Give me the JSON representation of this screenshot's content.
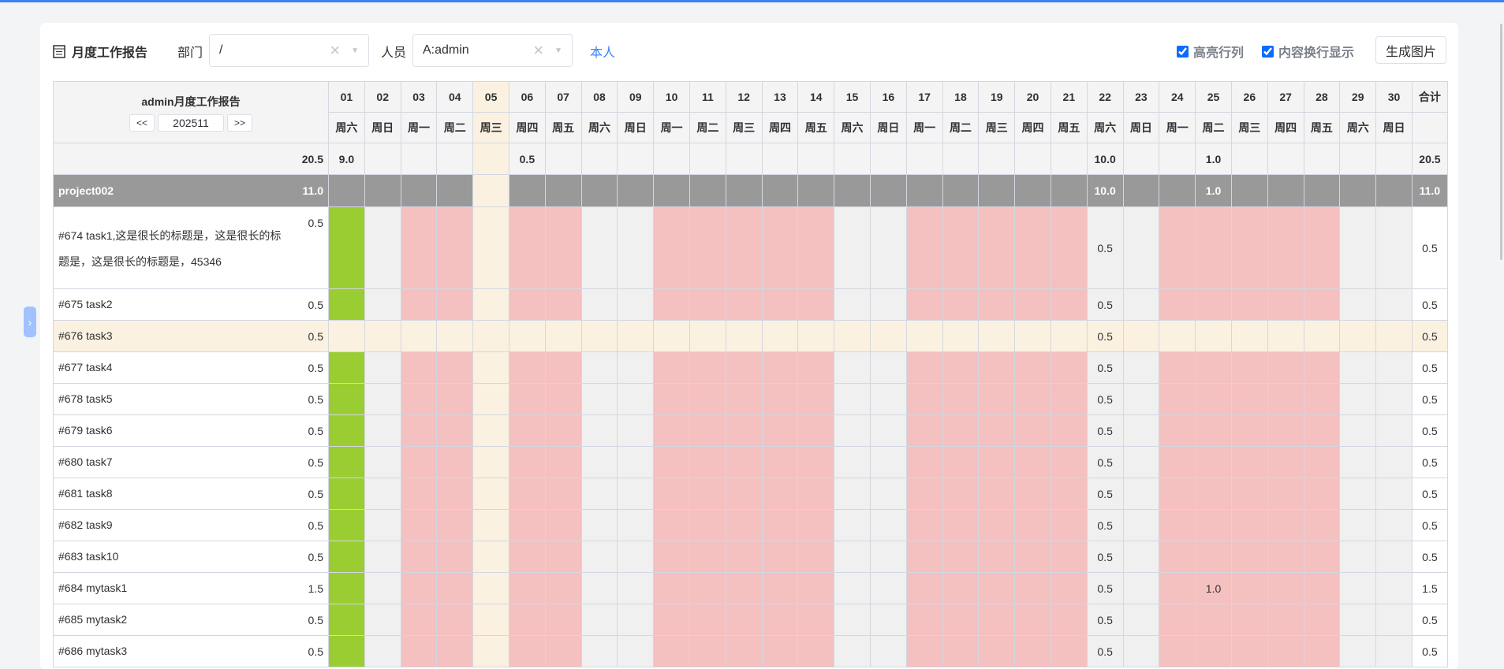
{
  "toolbar": {
    "title": "月度工作报告",
    "dept_label": "部门",
    "dept_value": "/",
    "person_label": "人员",
    "person_value": "A:admin",
    "self_link": "本人",
    "highlight_label": "高亮行列",
    "wrap_label": "内容换行显示",
    "generate_button": "生成图片"
  },
  "report": {
    "title": "admin月度工作报告",
    "prev": "<<",
    "month": "202511",
    "next": ">>",
    "total_label": "合计",
    "highlight_col": "05",
    "highlight_row": "#676 task3"
  },
  "days": [
    {
      "d": "01",
      "w": "周六",
      "status": "full"
    },
    {
      "d": "02",
      "w": "周日",
      "status": "weekend"
    },
    {
      "d": "03",
      "w": "周一",
      "status": "under"
    },
    {
      "d": "04",
      "w": "周二",
      "status": "under"
    },
    {
      "d": "05",
      "w": "周三",
      "status": "under"
    },
    {
      "d": "06",
      "w": "周四",
      "status": "under"
    },
    {
      "d": "07",
      "w": "周五",
      "status": "under"
    },
    {
      "d": "08",
      "w": "周六",
      "status": "weekend"
    },
    {
      "d": "09",
      "w": "周日",
      "status": "weekend"
    },
    {
      "d": "10",
      "w": "周一",
      "status": "under"
    },
    {
      "d": "11",
      "w": "周二",
      "status": "under"
    },
    {
      "d": "12",
      "w": "周三",
      "status": "under"
    },
    {
      "d": "13",
      "w": "周四",
      "status": "under"
    },
    {
      "d": "14",
      "w": "周五",
      "status": "under"
    },
    {
      "d": "15",
      "w": "周六",
      "status": "weekend"
    },
    {
      "d": "16",
      "w": "周日",
      "status": "weekend"
    },
    {
      "d": "17",
      "w": "周一",
      "status": "under"
    },
    {
      "d": "18",
      "w": "周二",
      "status": "under"
    },
    {
      "d": "19",
      "w": "周三",
      "status": "under"
    },
    {
      "d": "20",
      "w": "周四",
      "status": "under"
    },
    {
      "d": "21",
      "w": "周五",
      "status": "under"
    },
    {
      "d": "22",
      "w": "周六",
      "status": "weekend"
    },
    {
      "d": "23",
      "w": "周日",
      "status": "weekend"
    },
    {
      "d": "24",
      "w": "周一",
      "status": "under"
    },
    {
      "d": "25",
      "w": "周二",
      "status": "under"
    },
    {
      "d": "26",
      "w": "周三",
      "status": "under"
    },
    {
      "d": "27",
      "w": "周四",
      "status": "under"
    },
    {
      "d": "28",
      "w": "周五",
      "status": "under"
    },
    {
      "d": "29",
      "w": "周六",
      "status": "weekend"
    },
    {
      "d": "30",
      "w": "周日",
      "status": "weekend"
    }
  ],
  "summary": {
    "total": "20.5",
    "values": {
      "01": "9.0",
      "06": "0.5",
      "22": "10.0",
      "25": "1.0"
    },
    "sum": "20.5"
  },
  "project": {
    "name": "project002",
    "total": "11.0",
    "values": {
      "22": "10.0",
      "25": "1.0"
    },
    "sum": "11.0"
  },
  "tasks": [
    {
      "name": "#674 task1,这是很长的标题是，这是很长的标题是，这是很长的标题是，45346",
      "total": "0.5",
      "values": {
        "22": "0.5"
      },
      "sum": "0.5"
    },
    {
      "name": "#675 task2",
      "total": "0.5",
      "values": {
        "22": "0.5"
      },
      "sum": "0.5"
    },
    {
      "name": "#676 task3",
      "total": "0.5",
      "values": {
        "22": "0.5"
      },
      "sum": "0.5"
    },
    {
      "name": "#677 task4",
      "total": "0.5",
      "values": {
        "22": "0.5"
      },
      "sum": "0.5"
    },
    {
      "name": "#678 task5",
      "total": "0.5",
      "values": {
        "22": "0.5"
      },
      "sum": "0.5"
    },
    {
      "name": "#679 task6",
      "total": "0.5",
      "values": {
        "22": "0.5"
      },
      "sum": "0.5"
    },
    {
      "name": "#680 task7",
      "total": "0.5",
      "values": {
        "22": "0.5"
      },
      "sum": "0.5"
    },
    {
      "name": "#681 task8",
      "total": "0.5",
      "values": {
        "22": "0.5"
      },
      "sum": "0.5"
    },
    {
      "name": "#682 task9",
      "total": "0.5",
      "values": {
        "22": "0.5"
      },
      "sum": "0.5"
    },
    {
      "name": "#683 task10",
      "total": "0.5",
      "values": {
        "22": "0.5"
      },
      "sum": "0.5"
    },
    {
      "name": "#684 mytask1",
      "total": "1.5",
      "values": {
        "22": "0.5",
        "25": "1.0"
      },
      "sum": "1.5"
    },
    {
      "name": "#685 mytask2",
      "total": "0.5",
      "values": {
        "22": "0.5"
      },
      "sum": "0.5"
    },
    {
      "name": "#686 mytask3",
      "total": "0.5",
      "values": {
        "22": "0.5"
      },
      "sum": "0.5"
    }
  ],
  "colors": {
    "full": "#9acd32",
    "weekend": "#f0f0f0",
    "under": "#f5c0c0",
    "highlight": "#faf1e0",
    "project": "#999999",
    "accent": "#3b82f6"
  }
}
